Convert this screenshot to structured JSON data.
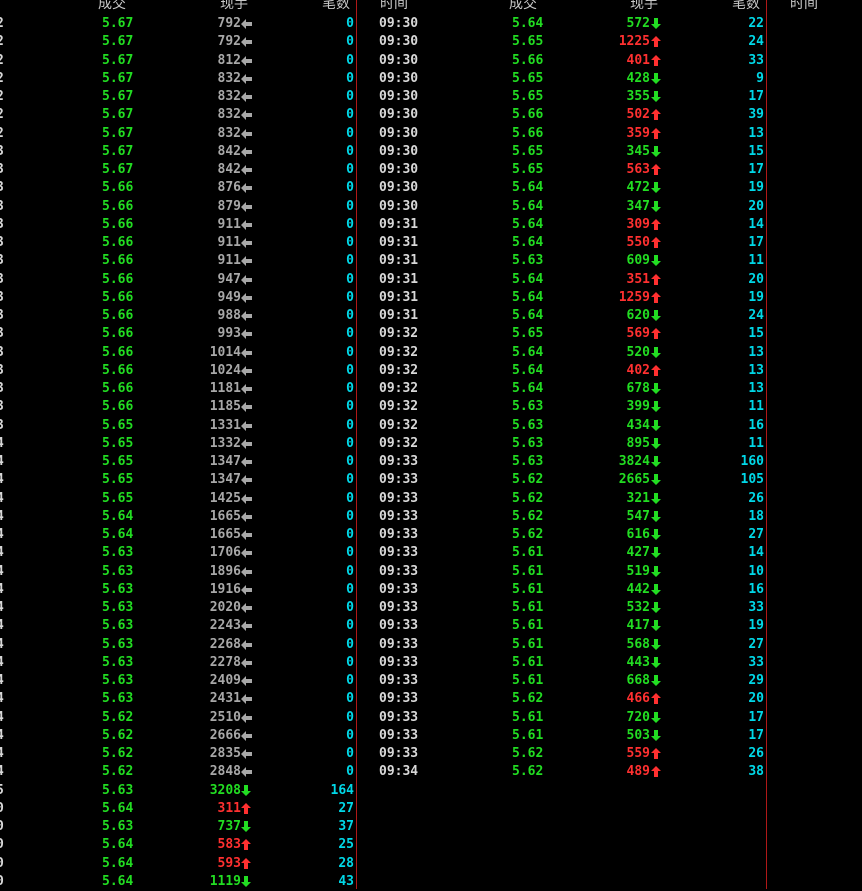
{
  "headers": {
    "left": {
      "price": "成交",
      "volume": "现手",
      "count": "笔数"
    },
    "right": {
      "time": "时间",
      "price": "成交",
      "volume": "现手",
      "count": "笔数",
      "time2": "时间"
    }
  },
  "colors": {
    "green": "#22dd22",
    "red": "#ff3030",
    "grey": "#a8a8a8",
    "cyan": "#00d8e8",
    "divider": "#b01818"
  },
  "left_rows": [
    {
      "tl": "2",
      "p": "5.67",
      "v": "792",
      "d": "flat",
      "n": "0"
    },
    {
      "tl": "2",
      "p": "5.67",
      "v": "792",
      "d": "flat",
      "n": "0"
    },
    {
      "tl": "2",
      "p": "5.67",
      "v": "812",
      "d": "flat",
      "n": "0"
    },
    {
      "tl": "2",
      "p": "5.67",
      "v": "832",
      "d": "flat",
      "n": "0"
    },
    {
      "tl": "2",
      "p": "5.67",
      "v": "832",
      "d": "flat",
      "n": "0"
    },
    {
      "tl": "2",
      "p": "5.67",
      "v": "832",
      "d": "flat",
      "n": "0"
    },
    {
      "tl": "2",
      "p": "5.67",
      "v": "832",
      "d": "flat",
      "n": "0"
    },
    {
      "tl": "3",
      "p": "5.67",
      "v": "842",
      "d": "flat",
      "n": "0"
    },
    {
      "tl": "3",
      "p": "5.67",
      "v": "842",
      "d": "flat",
      "n": "0"
    },
    {
      "tl": "3",
      "p": "5.66",
      "v": "876",
      "d": "flat",
      "n": "0"
    },
    {
      "tl": "3",
      "p": "5.66",
      "v": "879",
      "d": "flat",
      "n": "0"
    },
    {
      "tl": "3",
      "p": "5.66",
      "v": "911",
      "d": "flat",
      "n": "0"
    },
    {
      "tl": "3",
      "p": "5.66",
      "v": "911",
      "d": "flat",
      "n": "0"
    },
    {
      "tl": "3",
      "p": "5.66",
      "v": "911",
      "d": "flat",
      "n": "0"
    },
    {
      "tl": "3",
      "p": "5.66",
      "v": "947",
      "d": "flat",
      "n": "0"
    },
    {
      "tl": "3",
      "p": "5.66",
      "v": "949",
      "d": "flat",
      "n": "0"
    },
    {
      "tl": "3",
      "p": "5.66",
      "v": "988",
      "d": "flat",
      "n": "0"
    },
    {
      "tl": "3",
      "p": "5.66",
      "v": "993",
      "d": "flat",
      "n": "0"
    },
    {
      "tl": "3",
      "p": "5.66",
      "v": "1014",
      "d": "flat",
      "n": "0"
    },
    {
      "tl": "3",
      "p": "5.66",
      "v": "1024",
      "d": "flat",
      "n": "0"
    },
    {
      "tl": "3",
      "p": "5.66",
      "v": "1181",
      "d": "flat",
      "n": "0"
    },
    {
      "tl": "3",
      "p": "5.66",
      "v": "1185",
      "d": "flat",
      "n": "0"
    },
    {
      "tl": "3",
      "p": "5.65",
      "v": "1331",
      "d": "flat",
      "n": "0"
    },
    {
      "tl": "4",
      "p": "5.65",
      "v": "1332",
      "d": "flat",
      "n": "0"
    },
    {
      "tl": "4",
      "p": "5.65",
      "v": "1347",
      "d": "flat",
      "n": "0"
    },
    {
      "tl": "4",
      "p": "5.65",
      "v": "1347",
      "d": "flat",
      "n": "0"
    },
    {
      "tl": "4",
      "p": "5.65",
      "v": "1425",
      "d": "flat",
      "n": "0"
    },
    {
      "tl": "4",
      "p": "5.64",
      "v": "1665",
      "d": "flat",
      "n": "0"
    },
    {
      "tl": "4",
      "p": "5.64",
      "v": "1665",
      "d": "flat",
      "n": "0"
    },
    {
      "tl": "4",
      "p": "5.63",
      "v": "1706",
      "d": "flat",
      "n": "0"
    },
    {
      "tl": "4",
      "p": "5.63",
      "v": "1896",
      "d": "flat",
      "n": "0"
    },
    {
      "tl": "4",
      "p": "5.63",
      "v": "1916",
      "d": "flat",
      "n": "0"
    },
    {
      "tl": "4",
      "p": "5.63",
      "v": "2020",
      "d": "flat",
      "n": "0"
    },
    {
      "tl": "4",
      "p": "5.63",
      "v": "2243",
      "d": "flat",
      "n": "0"
    },
    {
      "tl": "4",
      "p": "5.63",
      "v": "2268",
      "d": "flat",
      "n": "0"
    },
    {
      "tl": "4",
      "p": "5.63",
      "v": "2278",
      "d": "flat",
      "n": "0"
    },
    {
      "tl": "4",
      "p": "5.63",
      "v": "2409",
      "d": "flat",
      "n": "0"
    },
    {
      "tl": "4",
      "p": "5.63",
      "v": "2431",
      "d": "flat",
      "n": "0"
    },
    {
      "tl": "4",
      "p": "5.62",
      "v": "2510",
      "d": "flat",
      "n": "0"
    },
    {
      "tl": "4",
      "p": "5.62",
      "v": "2666",
      "d": "flat",
      "n": "0"
    },
    {
      "tl": "4",
      "p": "5.62",
      "v": "2835",
      "d": "flat",
      "n": "0"
    },
    {
      "tl": "4",
      "p": "5.62",
      "v": "2848",
      "d": "flat",
      "n": "0"
    },
    {
      "tl": "5",
      "p": "5.63",
      "v": "3208",
      "d": "down",
      "n": "164"
    },
    {
      "tl": "0",
      "p": "5.64",
      "v": "311",
      "d": "up",
      "n": "27"
    },
    {
      "tl": "0",
      "p": "5.63",
      "v": "737",
      "d": "down",
      "n": "37"
    },
    {
      "tl": "0",
      "p": "5.64",
      "v": "583",
      "d": "up",
      "n": "25"
    },
    {
      "tl": "0",
      "p": "5.64",
      "v": "593",
      "d": "up",
      "n": "28"
    },
    {
      "tl": "0",
      "p": "5.64",
      "v": "1119",
      "d": "down",
      "n": "43"
    }
  ],
  "right_rows": [
    {
      "t": "09:30",
      "p": "5.64",
      "v": "572",
      "d": "down",
      "n": "22"
    },
    {
      "t": "09:30",
      "p": "5.65",
      "v": "1225",
      "d": "up",
      "n": "24"
    },
    {
      "t": "09:30",
      "p": "5.66",
      "v": "401",
      "d": "up",
      "n": "33"
    },
    {
      "t": "09:30",
      "p": "5.65",
      "v": "428",
      "d": "down",
      "n": "9"
    },
    {
      "t": "09:30",
      "p": "5.65",
      "v": "355",
      "d": "down",
      "n": "17"
    },
    {
      "t": "09:30",
      "p": "5.66",
      "v": "502",
      "d": "up",
      "n": "39"
    },
    {
      "t": "09:30",
      "p": "5.66",
      "v": "359",
      "d": "up",
      "n": "13"
    },
    {
      "t": "09:30",
      "p": "5.65",
      "v": "345",
      "d": "down",
      "n": "15"
    },
    {
      "t": "09:30",
      "p": "5.65",
      "v": "563",
      "d": "up",
      "n": "17"
    },
    {
      "t": "09:30",
      "p": "5.64",
      "v": "472",
      "d": "down",
      "n": "19"
    },
    {
      "t": "09:30",
      "p": "5.64",
      "v": "347",
      "d": "down",
      "n": "20"
    },
    {
      "t": "09:31",
      "p": "5.64",
      "v": "309",
      "d": "up",
      "n": "14"
    },
    {
      "t": "09:31",
      "p": "5.64",
      "v": "550",
      "d": "up",
      "n": "17"
    },
    {
      "t": "09:31",
      "p": "5.63",
      "v": "609",
      "d": "down",
      "n": "11"
    },
    {
      "t": "09:31",
      "p": "5.64",
      "v": "351",
      "d": "up",
      "n": "20"
    },
    {
      "t": "09:31",
      "p": "5.64",
      "v": "1259",
      "d": "up",
      "n": "19"
    },
    {
      "t": "09:31",
      "p": "5.64",
      "v": "620",
      "d": "down",
      "n": "24"
    },
    {
      "t": "09:32",
      "p": "5.65",
      "v": "569",
      "d": "up",
      "n": "15"
    },
    {
      "t": "09:32",
      "p": "5.64",
      "v": "520",
      "d": "down",
      "n": "13"
    },
    {
      "t": "09:32",
      "p": "5.64",
      "v": "402",
      "d": "up",
      "n": "13"
    },
    {
      "t": "09:32",
      "p": "5.64",
      "v": "678",
      "d": "down",
      "n": "13"
    },
    {
      "t": "09:32",
      "p": "5.63",
      "v": "399",
      "d": "down",
      "n": "11"
    },
    {
      "t": "09:32",
      "p": "5.63",
      "v": "434",
      "d": "down",
      "n": "16"
    },
    {
      "t": "09:32",
      "p": "5.63",
      "v": "895",
      "d": "down",
      "n": "11"
    },
    {
      "t": "09:33",
      "p": "5.63",
      "v": "3824",
      "d": "down",
      "n": "160"
    },
    {
      "t": "09:33",
      "p": "5.62",
      "v": "2665",
      "d": "down",
      "n": "105"
    },
    {
      "t": "09:33",
      "p": "5.62",
      "v": "321",
      "d": "down",
      "n": "26"
    },
    {
      "t": "09:33",
      "p": "5.62",
      "v": "547",
      "d": "down",
      "n": "18"
    },
    {
      "t": "09:33",
      "p": "5.62",
      "v": "616",
      "d": "down",
      "n": "27"
    },
    {
      "t": "09:33",
      "p": "5.61",
      "v": "427",
      "d": "down",
      "n": "14"
    },
    {
      "t": "09:33",
      "p": "5.61",
      "v": "519",
      "d": "down",
      "n": "10"
    },
    {
      "t": "09:33",
      "p": "5.61",
      "v": "442",
      "d": "down",
      "n": "16"
    },
    {
      "t": "09:33",
      "p": "5.61",
      "v": "532",
      "d": "down",
      "n": "33"
    },
    {
      "t": "09:33",
      "p": "5.61",
      "v": "417",
      "d": "down",
      "n": "19"
    },
    {
      "t": "09:33",
      "p": "5.61",
      "v": "568",
      "d": "down",
      "n": "27"
    },
    {
      "t": "09:33",
      "p": "5.61",
      "v": "443",
      "d": "down",
      "n": "33"
    },
    {
      "t": "09:33",
      "p": "5.61",
      "v": "668",
      "d": "down",
      "n": "29"
    },
    {
      "t": "09:33",
      "p": "5.62",
      "v": "466",
      "d": "up",
      "n": "20"
    },
    {
      "t": "09:33",
      "p": "5.61",
      "v": "720",
      "d": "down",
      "n": "17"
    },
    {
      "t": "09:33",
      "p": "5.61",
      "v": "503",
      "d": "down",
      "n": "17"
    },
    {
      "t": "09:33",
      "p": "5.62",
      "v": "559",
      "d": "up",
      "n": "26"
    },
    {
      "t": "09:34",
      "p": "5.62",
      "v": "489",
      "d": "up",
      "n": "38"
    }
  ]
}
